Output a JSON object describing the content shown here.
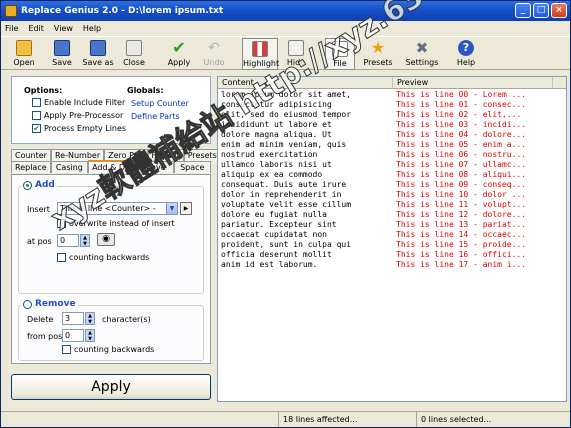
{
  "window": {
    "title": "Replace Genius 2.0 - D:\\lorem ipsum.txt"
  },
  "menu": [
    "File",
    "Edit",
    "View",
    "Help"
  ],
  "toolbar": {
    "open": "Open",
    "save": "Save",
    "save_as": "Save as",
    "close": "Close",
    "apply": "Apply",
    "undo": "Undo",
    "highlight": "Highlight",
    "hide": "Hide",
    "file": "File",
    "presets": "Presets",
    "settings": "Settings",
    "help": "Help"
  },
  "options": {
    "title": "Options:",
    "enable_include_filter": "Enable Include Filter",
    "apply_preprocessor": "Apply Pre-Processor",
    "process_empty_lines": "Process Empty Lines"
  },
  "globals": {
    "title": "Globals:",
    "setup_counter": "Setup Counter",
    "define_parts": "Define Parts"
  },
  "tabs_row1": [
    "Counter",
    "Re-Number",
    "Zero Pad",
    "Format",
    "Presets"
  ],
  "tabs_row2": [
    "Replace",
    "Casing",
    "Add & Del",
    "Move",
    "Space"
  ],
  "add": {
    "title": "Add",
    "insert_label": "Insert",
    "insert_value": "This is line <Counter> -",
    "overwrite": "overwrite instead of insert",
    "at_pos_label": "at pos",
    "at_pos_value": "0",
    "counting_backwards": "counting backwards"
  },
  "remove": {
    "title": "Remove",
    "delete_label": "Delete",
    "delete_value": "3",
    "chars_label": "character(s)",
    "from_pos_label": "from pos",
    "from_pos_value": "0",
    "counting_backwards": "counting backwards"
  },
  "apply_button": "Apply",
  "grid": {
    "col_content": "Content",
    "col_preview": "Preview",
    "rows": [
      [
        "lorem ipsum dolor sit amet,",
        "This is line 00 - Lorem ..."
      ],
      [
        "consectetur adipisicing",
        "This is line 01 - consec..."
      ],
      [
        "elit, sed do eiusmod tempor",
        "This is line 02 - elit,..."
      ],
      [
        "incididunt ut labore et",
        "This is line 03 - incidi..."
      ],
      [
        "dolore magna aliqua. Ut",
        "This is line 04 - dolore..."
      ],
      [
        "enim ad minim veniam, quis",
        "This is line 05 - enim a..."
      ],
      [
        "nostrud exercitation",
        "This is line 06 - nostru..."
      ],
      [
        "ullamco laboris nisi ut",
        "This is line 07 - ullamc..."
      ],
      [
        "aliquip ex ea commodo",
        "This is line 08 - aliqui..."
      ],
      [
        "consequat. Duis aute irure",
        "This is line 09 - conseq..."
      ],
      [
        "dolor in reprehenderit in",
        "This is line 10 - dolor ..."
      ],
      [
        "voluptate velit esse cillum",
        "This is line 11 - volupt..."
      ],
      [
        "dolore eu fugiat nulla",
        "This is line 12 - dolore..."
      ],
      [
        "pariatur. Excepteur sint",
        "This is line 13 - pariat..."
      ],
      [
        "occaecat cupidatat non",
        "This is line 14 - occaec..."
      ],
      [
        "proident, sunt in culpa qui",
        "This is line 15 - proide..."
      ],
      [
        "officia deserunt mollit",
        "This is line 16 - offici..."
      ],
      [
        "anim id est laborum.",
        "This is line 17 - anim i..."
      ]
    ]
  },
  "status": {
    "lines_affected": "18 lines affected...",
    "lines_selected": "0 lines selected..."
  },
  "watermark": "xyz軟體補給站 http://xyz.631.to"
}
